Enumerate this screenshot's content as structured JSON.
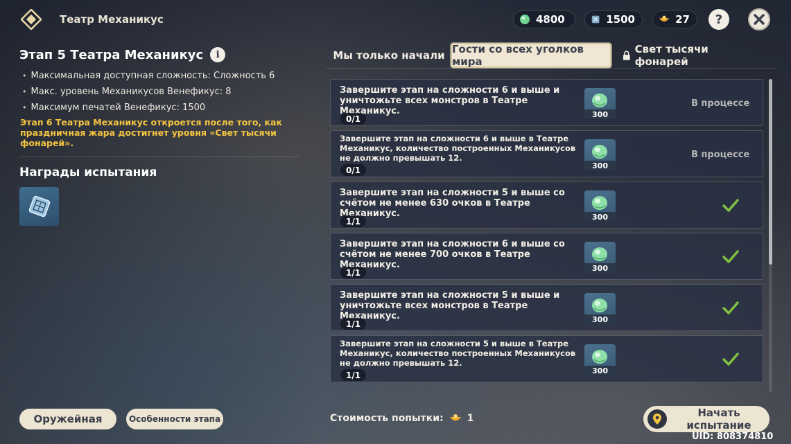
{
  "header": {
    "title": "Театр Механикус",
    "currencies": [
      {
        "icon": "green-gem-icon",
        "value": "4800"
      },
      {
        "icon": "blue-token-icon",
        "value": "1500"
      },
      {
        "icon": "golden-bowl-icon",
        "value": "27"
      }
    ],
    "help_label": "?",
    "close_icon": "close-icon"
  },
  "left": {
    "stage_title": "Этап 5 Театра Механикус",
    "info_label": "i",
    "stats": [
      "Максимальная доступная сложность: Сложность 6",
      "Макс. уровень Механикусов Венефикус: 8",
      "Максимум печатей Венефикус: 1500"
    ],
    "unlock_note": "Этап 6 Театра Механикус откроется после того, как праздничная жара достигнет уровня «Свет тысячи фонарей».",
    "rewards_title": "Награды испытания",
    "reward_icon": "seal-token-icon"
  },
  "tabs": [
    {
      "label": "Мы только начали",
      "active": false,
      "locked": false
    },
    {
      "label": "Гости со всех уголков мира",
      "active": true,
      "locked": false
    },
    {
      "label": "Свет тысячи фонарей",
      "active": false,
      "locked": true
    }
  ],
  "tasks": [
    {
      "text": "Завершите этап на сложности 6 и выше и уничтожьте всех монстров в Театре Механикус.",
      "progress": "0/1",
      "reward_qty": "300",
      "status": "В процессе",
      "done": false,
      "small": false
    },
    {
      "text": "Завершите этап на сложности 6 и выше в Театре Механикус, количество построенных Механикусов не должно превышать 12.",
      "progress": "0/1",
      "reward_qty": "300",
      "status": "В процессе",
      "done": false,
      "small": true
    },
    {
      "text": "Завершите этап на сложности 5 и выше со счётом не менее 630 очков в Театре Механикус.",
      "progress": "1/1",
      "reward_qty": "300",
      "status": "",
      "done": true,
      "small": false
    },
    {
      "text": "Завершите этап на сложности 6 и выше со счётом не менее 700 очков в Театре Механикус.",
      "progress": "1/1",
      "reward_qty": "300",
      "status": "",
      "done": true,
      "small": false
    },
    {
      "text": "Завершите этап на сложности 5 и выше и уничтожьте всех монстров в Театре Механикус.",
      "progress": "1/1",
      "reward_qty": "300",
      "status": "",
      "done": true,
      "small": false
    },
    {
      "text": "Завершите этап на сложности 5 и выше в Театре Механикус, количество построенных Механикусов не должно превышать 12.",
      "progress": "1/1",
      "reward_qty": "300",
      "status": "",
      "done": true,
      "small": true
    }
  ],
  "footer": {
    "armory_label": "Оружейная",
    "features_label": "Особенности этапа",
    "cost_label": "Стоимость попытки:",
    "cost_value": "1",
    "start_label": "Начать испытание",
    "uid": "UID: 808374810"
  },
  "colors": {
    "accent_gold": "#f5c542",
    "panel_cream": "#ece5d2",
    "check_green": "#7fc241"
  }
}
